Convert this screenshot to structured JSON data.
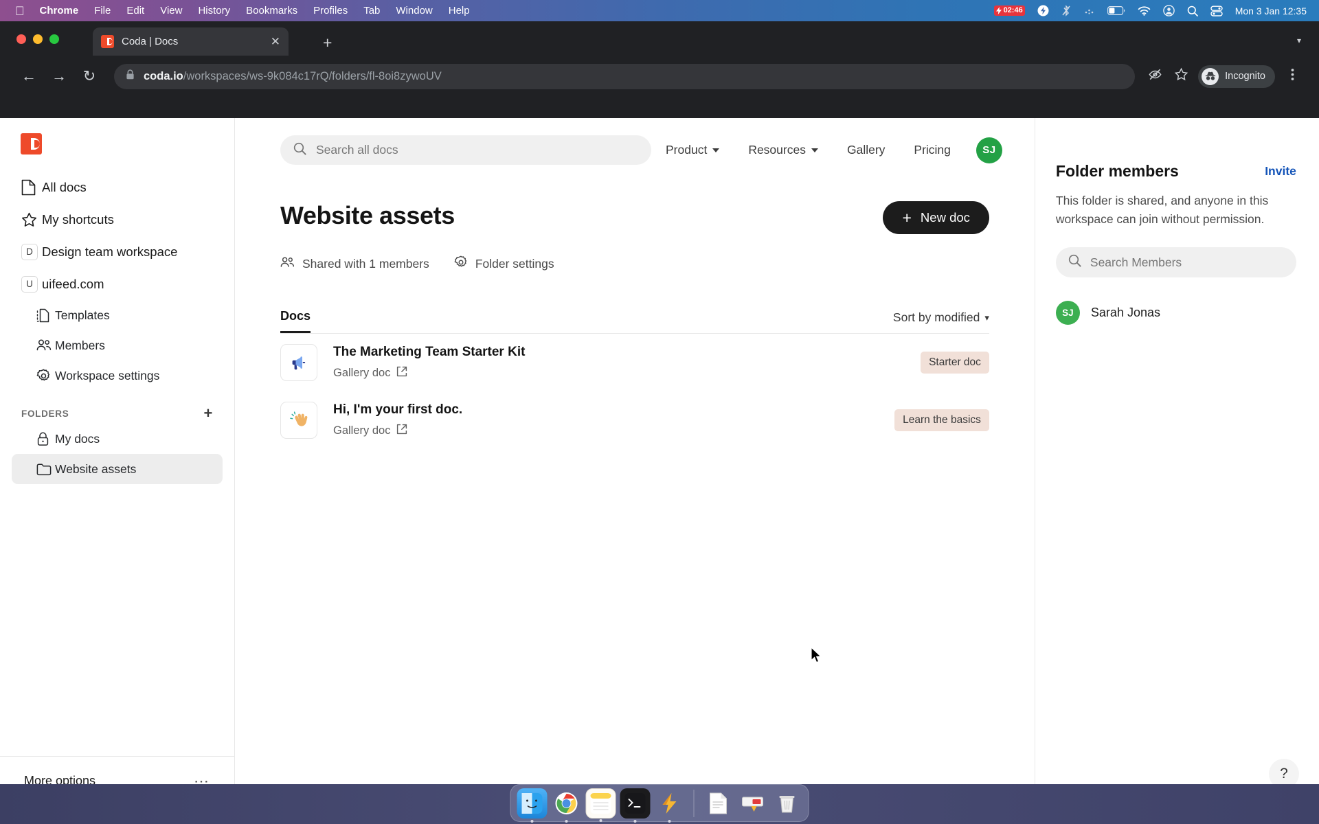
{
  "menubar": {
    "apple_icon": "apple-icon",
    "items": [
      {
        "label": "Chrome",
        "bold": true
      },
      {
        "label": "File",
        "bold": false
      },
      {
        "label": "Edit",
        "bold": false
      },
      {
        "label": "View",
        "bold": false
      },
      {
        "label": "History",
        "bold": false
      },
      {
        "label": "Bookmarks",
        "bold": false
      },
      {
        "label": "Profiles",
        "bold": false
      },
      {
        "label": "Tab",
        "bold": false
      },
      {
        "label": "Window",
        "bold": false
      },
      {
        "label": "Help",
        "bold": false
      }
    ],
    "status": {
      "battery_timer": "02:46",
      "icons": [
        "bolt-icon",
        "bluetooth-off-icon",
        "dots-icon",
        "battery-icon",
        "wifi-icon",
        "control-center-icon",
        "search-icon",
        "toggles-icon"
      ],
      "datetime": "Mon 3 Jan  12:35"
    }
  },
  "browser": {
    "tab": {
      "title": "Coda | Docs",
      "favicon": "coda-favicon",
      "close_icon": "close-icon"
    },
    "new_tab_icon": "plus-icon",
    "tab_list_icon": "chevron-down-icon",
    "nav": {
      "back_icon": "back-arrow-icon",
      "forward_icon": "forward-arrow-icon",
      "reload_icon": "reload-icon"
    },
    "url": {
      "lock_icon": "lock-icon",
      "domain": "coda.io",
      "path": "/workspaces/ws-9k084c17rQ/folders/fl-8oi8zywoUV"
    },
    "toolbar_icons": [
      "eye-slash-icon",
      "star-icon",
      "menu-dots-icon"
    ],
    "incognito_label": "Incognito",
    "incognito_icon": "incognito-icon"
  },
  "sidebar": {
    "logo": "coda-logo",
    "items": [
      {
        "label": "All docs",
        "icon": "document-icon",
        "type": "icon"
      },
      {
        "label": "My shortcuts",
        "icon": "star-icon",
        "type": "icon"
      },
      {
        "label": "Design team workspace",
        "icon": "D",
        "type": "badge"
      },
      {
        "label": "uifeed.com",
        "icon": "U",
        "type": "badge"
      }
    ],
    "sub_items": [
      {
        "label": "Templates",
        "icon": "templates-icon"
      },
      {
        "label": "Members",
        "icon": "members-icon"
      },
      {
        "label": "Workspace settings",
        "icon": "gear-icon"
      }
    ],
    "folders_header": "FOLDERS",
    "folders_add_icon": "plus-icon",
    "folders": [
      {
        "label": "My docs",
        "icon": "lock-icon",
        "active": false
      },
      {
        "label": "Website assets",
        "icon": "folder-icon",
        "active": true
      }
    ],
    "more_options": {
      "label": "More options",
      "icon": "ellipsis-icon"
    }
  },
  "topnav": {
    "search": {
      "placeholder": "Search all docs",
      "icon": "search-icon"
    },
    "links": [
      {
        "label": "Product",
        "has_caret": true
      },
      {
        "label": "Resources",
        "has_caret": true
      },
      {
        "label": "Gallery",
        "has_caret": false
      },
      {
        "label": "Pricing",
        "has_caret": false
      }
    ],
    "avatar": {
      "initials": "SJ",
      "color": "#23a145"
    }
  },
  "main": {
    "title": "Website assets",
    "new_doc": {
      "label": "New doc",
      "icon": "plus-icon"
    },
    "meta": [
      {
        "label": "Shared with 1 members",
        "icon": "members-icon"
      },
      {
        "label": "Folder settings",
        "icon": "gear-icon"
      }
    ],
    "tab_label": "Docs",
    "sort_label": "Sort by modified",
    "sort_icon": "chevron-down-icon",
    "docs": [
      {
        "name": "The Marketing Team Starter Kit",
        "subtitle": "Gallery doc",
        "external_icon": "external-link-icon",
        "thumb": "megaphone-icon",
        "badge": "Starter doc"
      },
      {
        "name": "Hi, I'm your first doc.",
        "subtitle": "Gallery doc",
        "external_icon": "external-link-icon",
        "thumb": "waving-hand-icon",
        "badge": "Learn the basics"
      }
    ]
  },
  "right_panel": {
    "title": "Folder members",
    "invite_label": "Invite",
    "description": "This folder is shared, and anyone in this workspace can join without permission.",
    "search": {
      "placeholder": "Search Members",
      "icon": "search-icon"
    },
    "members": [
      {
        "name": "Sarah Jonas",
        "initials": "SJ",
        "color": "#3caf51"
      }
    ],
    "help_label": "?"
  },
  "dock": {
    "items": [
      {
        "name": "finder-icon",
        "glyph": "🙂"
      },
      {
        "name": "chrome-icon",
        "glyph": "◉"
      },
      {
        "name": "notes-icon",
        "glyph": "▤"
      },
      {
        "name": "terminal-icon",
        "glyph": ">_"
      },
      {
        "name": "lightning-icon",
        "glyph": "⚡"
      },
      {
        "name": "document-icon",
        "glyph": "📄"
      },
      {
        "name": "app-icon",
        "glyph": "▭"
      },
      {
        "name": "trash-icon",
        "glyph": "🗑"
      }
    ]
  },
  "colors": {
    "accent_red": "#ee4a2a",
    "badge_bg": "#f1e0d8",
    "link_blue": "#1454b8",
    "avatar_green": "#23a145"
  }
}
